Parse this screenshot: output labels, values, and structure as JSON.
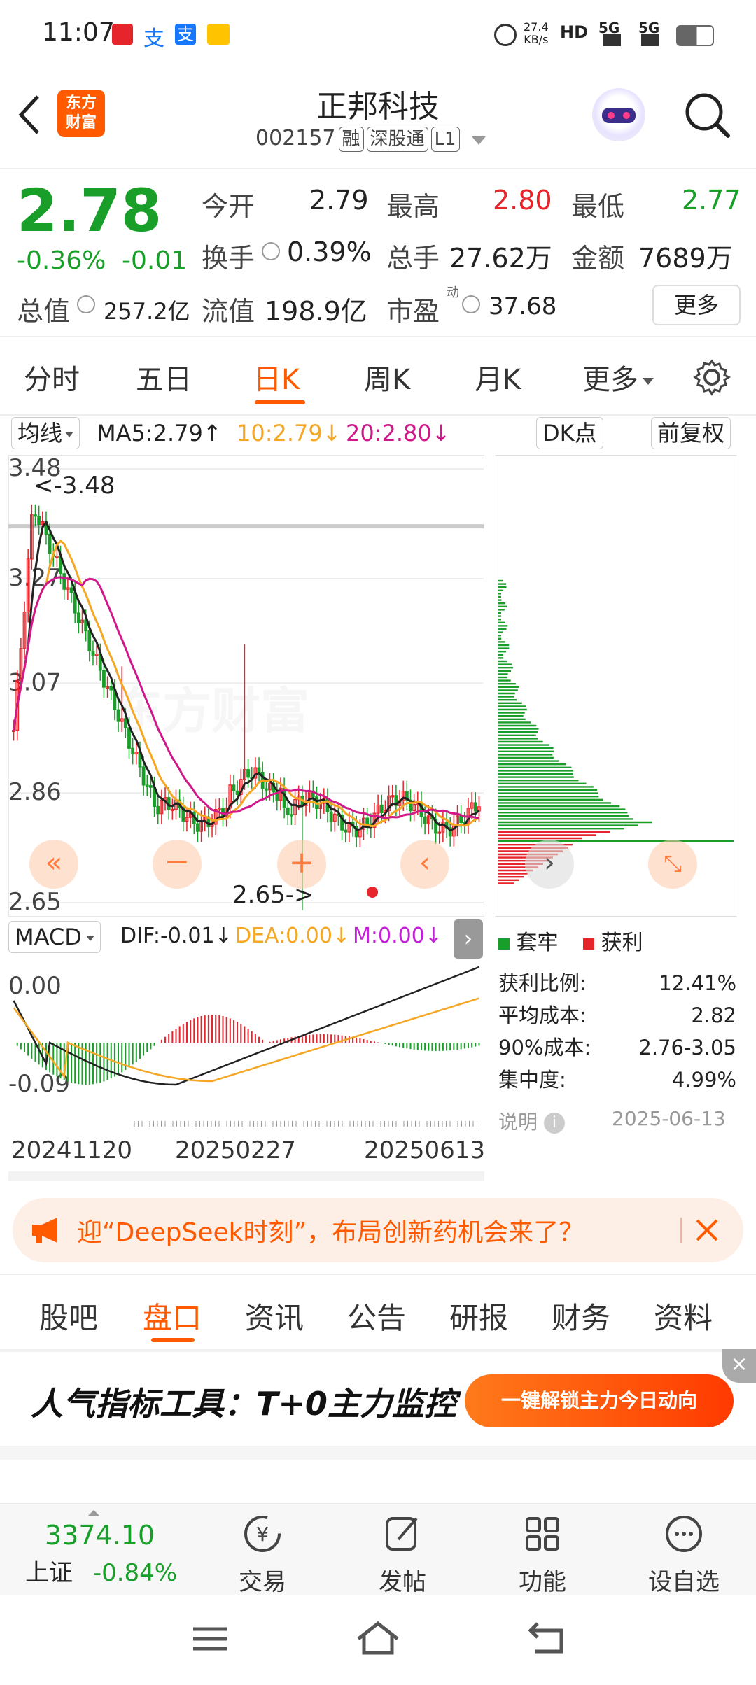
{
  "status": {
    "time": "11:07",
    "net_speed_top": "27.4",
    "net_speed_unit": "KB/s",
    "sig1": "5G",
    "sig2": "5G",
    "hd": "HD"
  },
  "header": {
    "title": "正邦科技",
    "code": "002157",
    "tags": [
      "融",
      "深股通",
      "L1"
    ],
    "logo_line1": "东方",
    "logo_line2": "财富"
  },
  "quote": {
    "price": "2.78",
    "change_pct": "-0.36%",
    "change": "-0.01",
    "open_label": "今开",
    "open": "2.79",
    "high_label": "最高",
    "high": "2.80",
    "low_label": "最低",
    "low": "2.77",
    "turnover_label": "换手",
    "turnover": "0.39%",
    "volume_label": "总手",
    "volume": "27.62万",
    "amount_label": "金额",
    "amount": "7689万",
    "mktcap_label": "总值",
    "mktcap": "257.2亿",
    "float_label": "流值",
    "float": "198.9亿",
    "pe_label": "市盈",
    "pe_sup": "动",
    "pe": "37.68",
    "more": "更多"
  },
  "tabs": {
    "items": [
      "分时",
      "五日",
      "日K",
      "周K",
      "月K",
      "更多"
    ],
    "active": "日K"
  },
  "chart": {
    "ma_label": "均线",
    "ma5": "MA5:2.79",
    "ma10": "10:2.79",
    "ma20": "20:2.80",
    "dk_label": "DK点",
    "adjust_label": "前复权",
    "price_ticks": [
      "3.48",
      "3.27",
      "3.07",
      "2.86",
      "2.65"
    ],
    "max_marker": "<-3.48",
    "min_marker": "2.65->",
    "macd_label": "MACD",
    "dif": "DIF:-0.01",
    "dea": "DEA:0.00",
    "m": "M:0.00",
    "macd_ticks": [
      "0.00",
      "-0.09"
    ],
    "dates": [
      "20241120",
      "20250227",
      "20250613"
    ],
    "colors": {
      "ma5": "#222222",
      "ma10": "#f5a623",
      "ma20": "#d0188a",
      "up": "#e5242b",
      "down": "#1a9e2a"
    }
  },
  "chips": {
    "legend_trapped": "套牢",
    "legend_profit": "获利",
    "rows": [
      {
        "label": "获利比例:",
        "value": "12.41%"
      },
      {
        "label": "平均成本:",
        "value": "2.82"
      },
      {
        "label": "90%成本:",
        "value": "2.76-3.05"
      },
      {
        "label": "集中度:",
        "value": "4.99%"
      }
    ],
    "note": "说明",
    "date": "2025-06-13"
  },
  "banner": {
    "text": "迎“DeepSeek时刻”，布局创新药机会来了？"
  },
  "bottom_tabs": {
    "items": [
      "股吧",
      "盘口",
      "资讯",
      "公告",
      "研报",
      "财务",
      "资料"
    ],
    "active": "盘口"
  },
  "ad": {
    "title": "人气指标工具：T+0主力监控",
    "button": "一键解锁主力今日动向"
  },
  "bottom_bar": {
    "index_value": "3374.10",
    "index_name": "上证",
    "index_change": "-0.84%",
    "trade": "交易",
    "post": "发帖",
    "func": "功能",
    "watch": "设自选"
  }
}
